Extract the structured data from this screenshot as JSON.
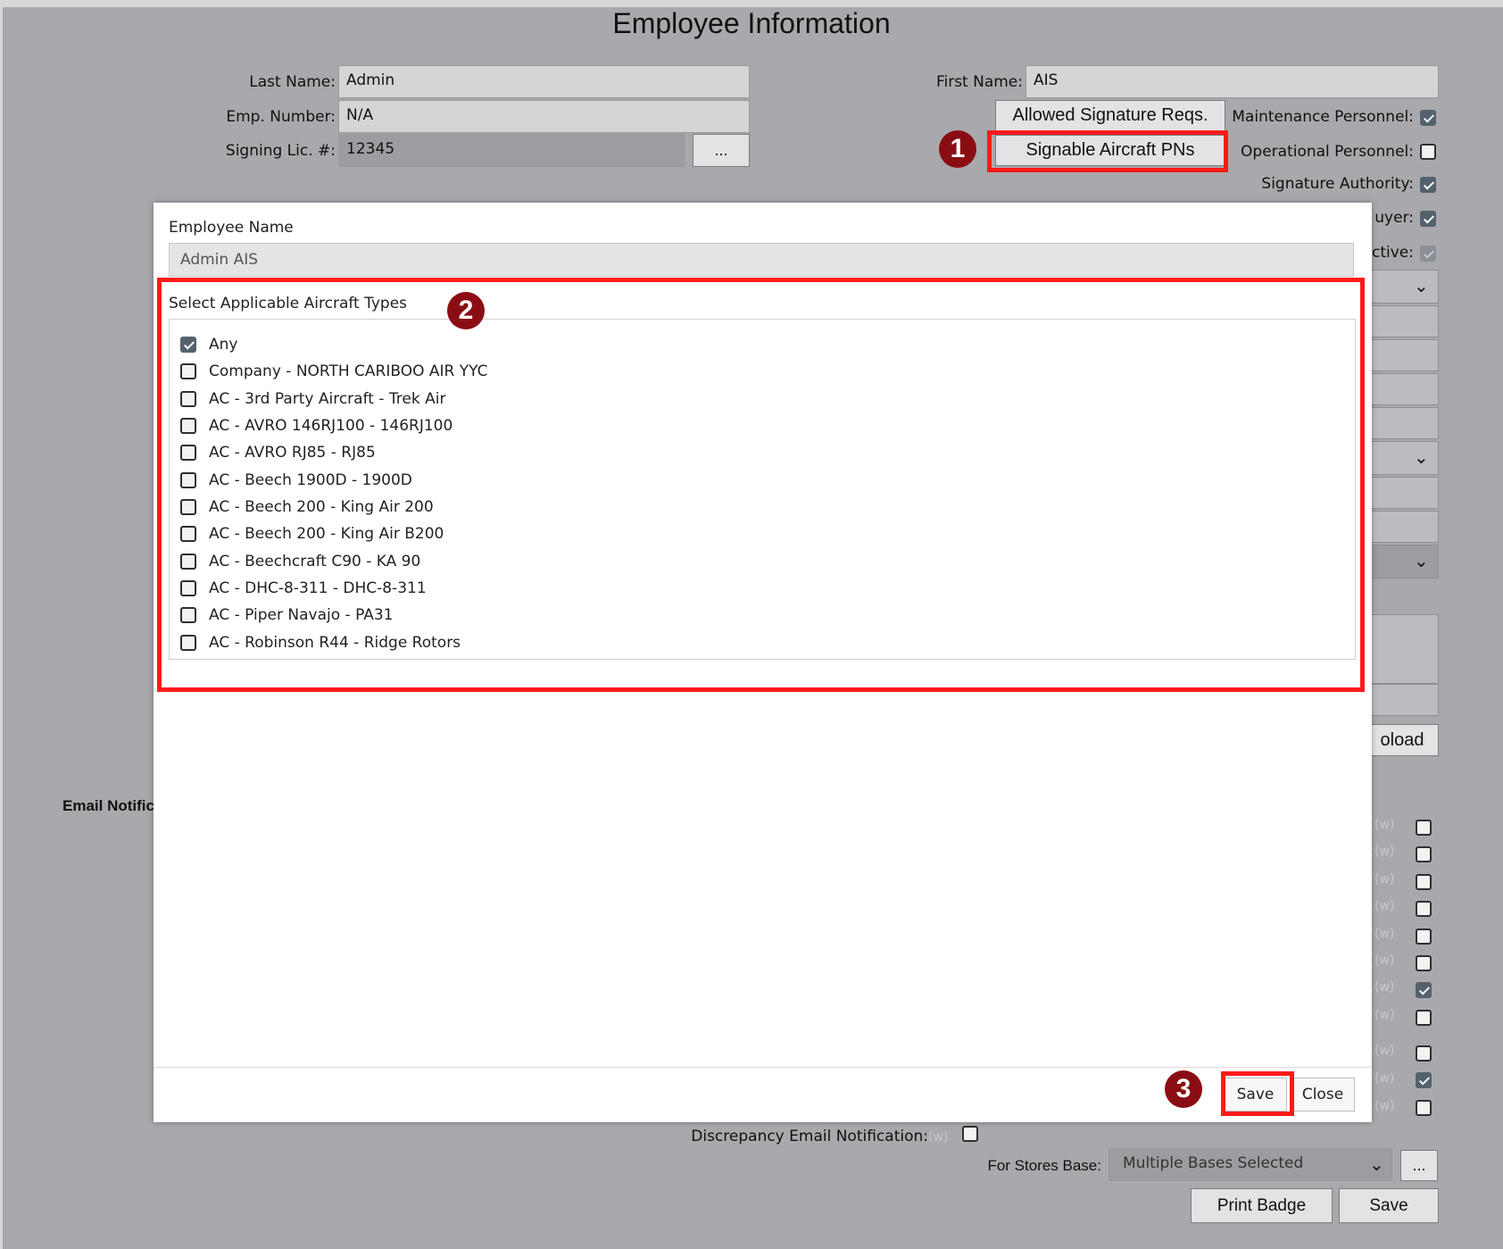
{
  "page": {
    "title": "Employee Information"
  },
  "form": {
    "last_name_label": "Last Name:",
    "last_name_value": "Admin",
    "first_name_label": "First Name:",
    "first_name_value": "AIS",
    "emp_number_label": "Emp. Number:",
    "emp_number_value": "N/A",
    "signing_lic_label": "Signing Lic. #:",
    "signing_lic_value": "12345",
    "ellipsis_label": "...",
    "allowed_sig_label": "Allowed Signature Reqs.",
    "signable_pns_label": "Signable Aircraft PNs",
    "maintenance_label": "Maintenance Personnel:",
    "operational_label": "Operational Personnel:",
    "signature_auth_label": "Signature Authority:",
    "buyer_partial": "uyer:",
    "active_partial": "ctive:",
    "upload_partial": "oload",
    "email_notif_partial": "Email Notific",
    "ghost_w": "(w)",
    "discrepancy_label": "Discrepancy Email Notification:",
    "discrepancy_w": "(w)",
    "stores_base_label": "For Stores Base:",
    "stores_base_value": "Multiple Bases Selected",
    "print_badge_label": "Print Badge",
    "save_label": "Save"
  },
  "modal": {
    "employee_name_label": "Employee Name",
    "employee_name_value": "Admin AIS",
    "select_types_label": "Select Applicable Aircraft Types",
    "items": [
      {
        "label": "Any",
        "checked": true
      },
      {
        "label": "Company - NORTH CARIBOO AIR YYC",
        "checked": false
      },
      {
        "label": "AC - 3rd Party Aircraft - Trek Air",
        "checked": false
      },
      {
        "label": "AC - AVRO 146RJ100 - 146RJ100",
        "checked": false
      },
      {
        "label": "AC - AVRO RJ85 - RJ85",
        "checked": false
      },
      {
        "label": "AC - Beech 1900D - 1900D",
        "checked": false
      },
      {
        "label": "AC - Beech 200 - King Air 200",
        "checked": false
      },
      {
        "label": "AC - Beech 200 - King Air B200",
        "checked": false
      },
      {
        "label": "AC - Beechcraft C90 - KA 90",
        "checked": false
      },
      {
        "label": "AC - DHC-8-311 - DHC-8-311",
        "checked": false
      },
      {
        "label": "AC - Piper Navajo - PA31",
        "checked": false
      },
      {
        "label": "AC - Robinson R44 - Ridge Rotors",
        "checked": false
      }
    ],
    "save_label": "Save",
    "close_label": "Close"
  },
  "annotations": {
    "badge_1": "1",
    "badge_2": "2",
    "badge_3": "3"
  },
  "colors": {
    "background": "#a9a8ac",
    "highlight": "#ff1a1a",
    "badge": "#8b0d14",
    "checked": "#54626e"
  }
}
